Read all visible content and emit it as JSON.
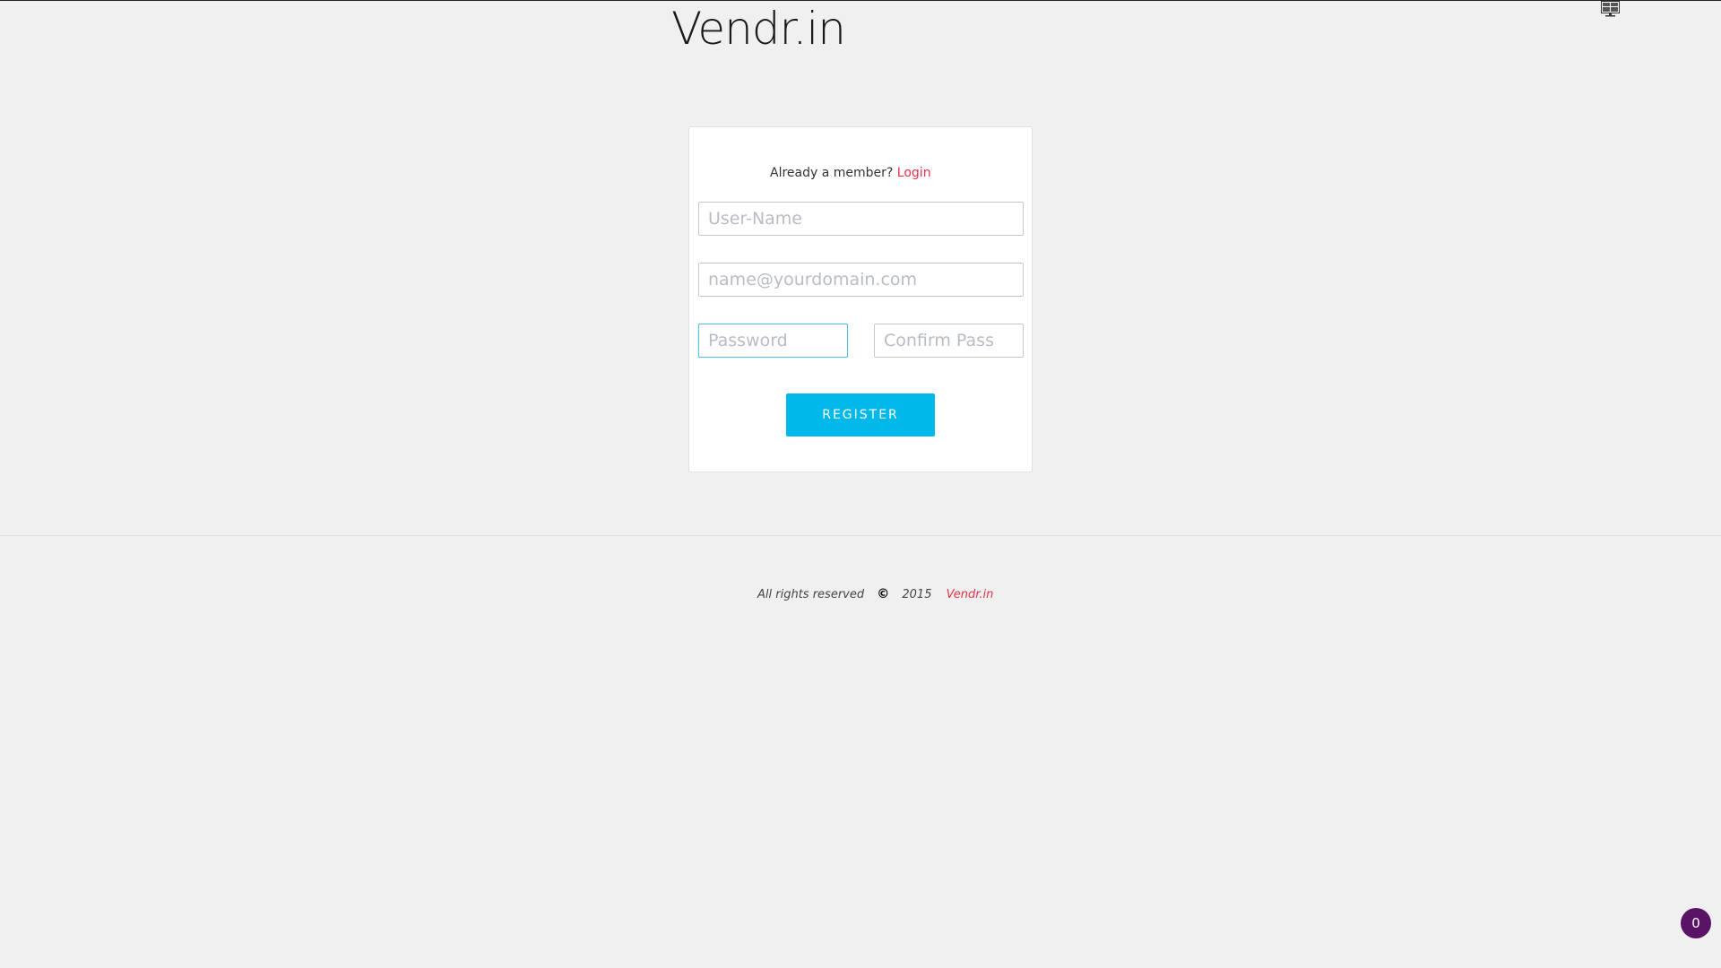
{
  "header": {
    "logo_text": "Vendr.in",
    "grid_icon": "grid-icon"
  },
  "register_form": {
    "member_prompt": "Already a member?",
    "login_link": "Login",
    "username_placeholder": "User-Name",
    "email_placeholder": "name@yourdomain.com",
    "password_placeholder": "Password",
    "confirm_placeholder": "Confirm Pass",
    "register_label": "REGISTER",
    "focused_field": "password"
  },
  "footer": {
    "rights_text": "All rights reserved",
    "copyright_icon": "©",
    "year": "2015",
    "brand_link": "Vendr.in"
  },
  "notification_badge": {
    "count": "0"
  },
  "colors": {
    "accent_button": "#00b9ea",
    "link": "#e8314a",
    "badge": "#5a1466",
    "background": "#f0f0f0"
  }
}
